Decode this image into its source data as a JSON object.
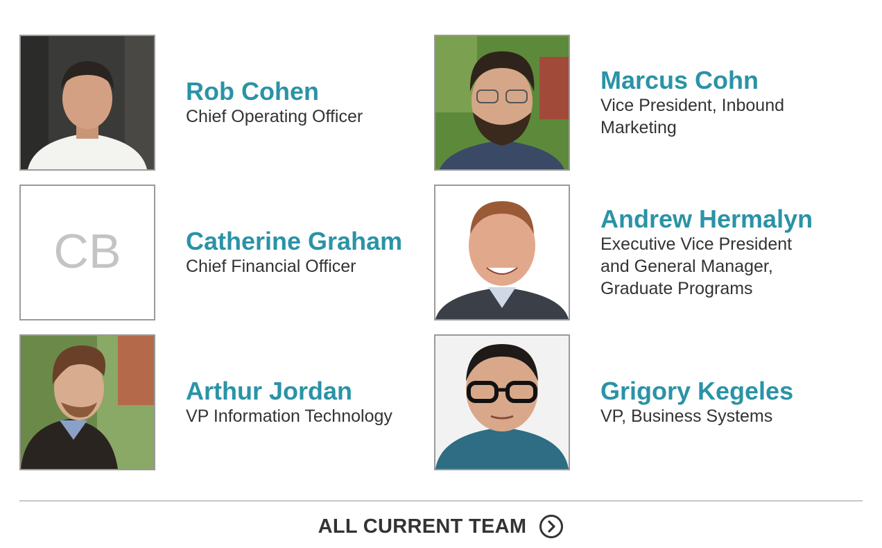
{
  "team": [
    {
      "name": "Rob Cohen",
      "title": "Chief Operating Officer",
      "photo": "person-photo",
      "bg": "#3a3a38",
      "shirt": "#f3f3ef"
    },
    {
      "name": "Marcus Cohn",
      "title": "Vice President, Inbound Marketing",
      "photo": "person-photo",
      "bg": "#5d8a3a",
      "shirt": "#3a4a66"
    },
    {
      "name": "Catherine Graham",
      "title": "Chief Financial Officer",
      "photo": "initials-placeholder",
      "initials": "CB"
    },
    {
      "name": "Andrew Hermalyn",
      "title": "Executive Vice President and General Manager, Graduate Programs",
      "photo": "person-photo",
      "bg": "#ffffff",
      "shirt": "#3a3f48"
    },
    {
      "name": "Arthur Jordan",
      "title": "VP Information Technology",
      "photo": "person-photo",
      "bg": "#6b8a4a",
      "shirt": "#2a2420"
    },
    {
      "name": "Grigory Kegeles",
      "title": "VP, Business Systems",
      "photo": "person-photo",
      "bg": "#f2f2f2",
      "shirt": "#2e6d84"
    }
  ],
  "footer": {
    "all_team_label": "ALL CURRENT TEAM",
    "icon": "chevron-right-circle-icon"
  },
  "colors": {
    "name_accent": "#2a93a6",
    "text": "#333333",
    "border": "#9a9a9a"
  }
}
